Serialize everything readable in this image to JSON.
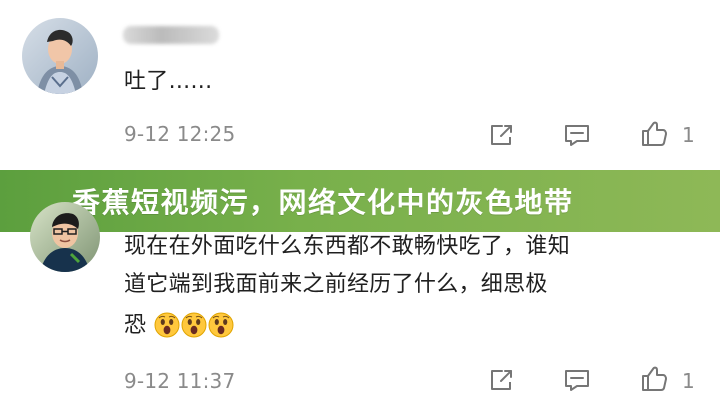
{
  "banner": {
    "title": "香蕉短视频污，网络文化中的灰色地带"
  },
  "comments": [
    {
      "text": "吐了......",
      "timestamp": "9-12 12:25",
      "like_count": "1",
      "avatar": "profile-photo-avatar",
      "username_obscured": true
    },
    {
      "text_line_1": "现在在外面吃什么东西都不敢畅快吃了，谁知",
      "text_line_2": "道它端到我面前来之前经历了什么，细思极",
      "text_line_3": "恐",
      "emojis": [
        "shocked-face-icon",
        "shocked-face-icon",
        "shocked-face-icon"
      ],
      "timestamp": "9-12 11:37",
      "avatar": "profile-photo-avatar"
    }
  ],
  "icons": {
    "share": "share-icon",
    "comment": "comment-icon",
    "like": "like-icon"
  },
  "colors": {
    "banner_start": "#5c9f3e",
    "banner_end": "#8eb857",
    "timestamp": "#8a8a8a",
    "icon": "#767676",
    "text": "#202020"
  }
}
